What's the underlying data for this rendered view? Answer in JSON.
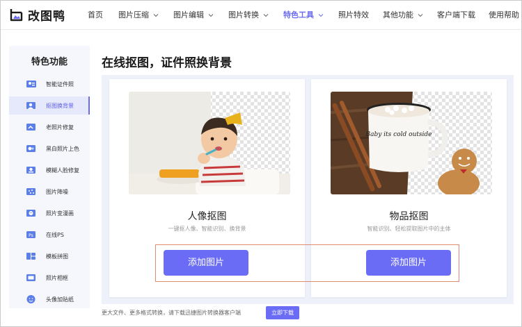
{
  "brand": {
    "name": "改图鸭"
  },
  "nav": {
    "items": [
      {
        "label": "首页",
        "dropdown": false,
        "active": false
      },
      {
        "label": "图片压缩",
        "dropdown": true,
        "active": false
      },
      {
        "label": "图片编辑",
        "dropdown": true,
        "active": false
      },
      {
        "label": "图片转换",
        "dropdown": true,
        "active": false
      },
      {
        "label": "特色工具",
        "dropdown": true,
        "active": true
      },
      {
        "label": "照片特效",
        "dropdown": false,
        "active": false
      },
      {
        "label": "其他功能",
        "dropdown": true,
        "active": false
      },
      {
        "label": "客户端下载",
        "dropdown": false,
        "active": false
      },
      {
        "label": "使用帮助",
        "dropdown": false,
        "active": false
      }
    ]
  },
  "sidebar": {
    "title": "特色功能",
    "items": [
      {
        "label": "智能证件照",
        "icon": "id-photo-icon",
        "active": false
      },
      {
        "label": "抠图换背景",
        "icon": "cutout-icon",
        "active": true
      },
      {
        "label": "老照片修复",
        "icon": "photo-repair-icon",
        "active": false
      },
      {
        "label": "黑白照片上色",
        "icon": "colorize-icon",
        "active": false
      },
      {
        "label": "模糊人脸修复",
        "icon": "face-repair-icon",
        "active": false
      },
      {
        "label": "图片降噪",
        "icon": "denoise-icon",
        "active": false
      },
      {
        "label": "照片变漫画",
        "icon": "cartoon-icon",
        "active": false
      },
      {
        "label": "在线PS",
        "icon": "ps-icon",
        "active": false
      },
      {
        "label": "模板拼图",
        "icon": "collage-icon",
        "active": false
      },
      {
        "label": "照片相框",
        "icon": "frame-icon",
        "active": false
      },
      {
        "label": "头像加贴纸",
        "icon": "sticker-icon",
        "active": false
      }
    ]
  },
  "main": {
    "title": "在线抠图，证件照换背景",
    "cards": [
      {
        "title": "人像抠图",
        "desc": "一键抠人像、智能识别、换背景",
        "button": "添加图片"
      },
      {
        "title": "物品抠图",
        "desc": "智能识别、轻松提取图片中的主体",
        "button": "添加图片"
      }
    ],
    "mug_text": "Baby its cold outside"
  },
  "footer": {
    "note": "更大文件、更多格式转换，请下载迅捷图片转换器客户端",
    "download_button": "立即下载"
  },
  "colors": {
    "accent": "#6b6cf5",
    "panel_bg": "#eef0fa",
    "highlight_border": "#e08a70"
  }
}
